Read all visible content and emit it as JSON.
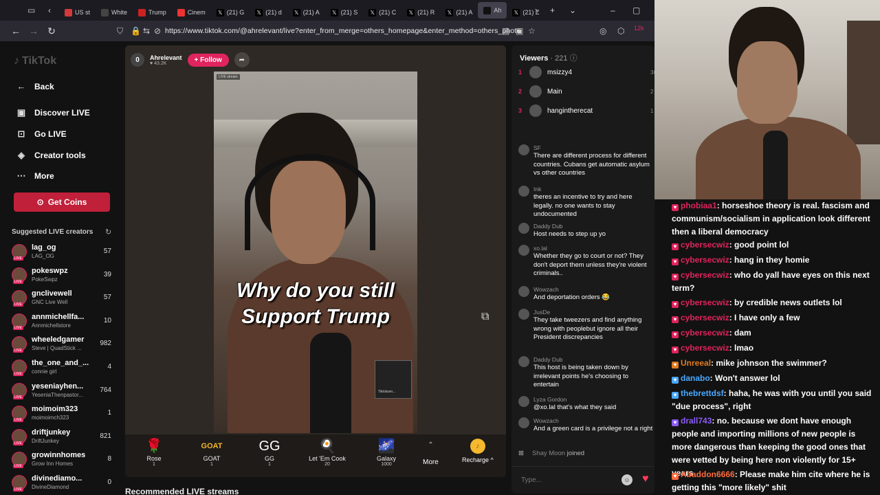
{
  "browser": {
    "tabs": [
      {
        "label": "US st",
        "color": "#d43a3a"
      },
      {
        "label": "White",
        "color": "#444"
      },
      {
        "label": "Trump",
        "color": "#c22"
      },
      {
        "label": "Cinem",
        "color": "#e33"
      },
      {
        "label": "(21) G",
        "color": "#000"
      },
      {
        "label": "(21) d",
        "color": "#000"
      },
      {
        "label": "(21) A",
        "color": "#000"
      },
      {
        "label": "(21) S",
        "color": "#000"
      },
      {
        "label": "(21) C",
        "color": "#000"
      },
      {
        "label": "(21) R",
        "color": "#000"
      },
      {
        "label": "(21) A",
        "color": "#000"
      },
      {
        "label": "Ah",
        "color": "#111"
      },
      {
        "label": "(21) Z",
        "color": "#000"
      }
    ],
    "url": "https://www.tiktok.com/@ahrelevant/live?enter_from_merge=others_homepage&enter_method=others_photo",
    "notification_count": "12k"
  },
  "sidebar": {
    "logo": "TikTok",
    "nav": [
      {
        "label": "Back",
        "icon": "←"
      },
      {
        "label": "Discover LIVE",
        "icon": "▣"
      },
      {
        "label": "Go LIVE",
        "icon": "⊡"
      },
      {
        "label": "Creator tools",
        "icon": "◈"
      },
      {
        "label": "More",
        "icon": "⋯"
      }
    ],
    "coins_label": "Get Coins",
    "suggested_title": "Suggested LIVE creators",
    "creators": [
      {
        "name": "lag_og",
        "sub": "LAG_OG",
        "count": "57"
      },
      {
        "name": "pokeswpz",
        "sub": "PokeSwpz",
        "count": "39"
      },
      {
        "name": "gnclivewell",
        "sub": "GNC Live Well",
        "count": "57"
      },
      {
        "name": "annmichellfa...",
        "sub": "Annmichellstore",
        "count": "10"
      },
      {
        "name": "wheeledgamer",
        "sub": "Steve | QuadStick ...",
        "count": "982"
      },
      {
        "name": "the_one_and_...",
        "sub": "connie girl",
        "count": "4"
      },
      {
        "name": "yeseniayhen...",
        "sub": "YeseniaThenpastor...",
        "count": "764"
      },
      {
        "name": "moimoim323",
        "sub": "moimoimch323",
        "count": "1"
      },
      {
        "name": "driftjunkey",
        "sub": "DriftJunkey",
        "count": "821"
      },
      {
        "name": "growinnhomes",
        "sub": "Grow Inn Homes",
        "count": "8"
      },
      {
        "name": "divinediamo...",
        "sub": "DivineDiamond",
        "count": "0"
      }
    ]
  },
  "stream": {
    "host_rank": "0",
    "host_name": "Ahrelevant",
    "host_likes": "♥ 43.2K",
    "follow_label": "+ Follow",
    "overlay_line1": "Why do you  still",
    "overlay_line2": "Support Trump",
    "badge": "LIVE stream",
    "pip_label": "Tiktoksen...",
    "gifts": [
      {
        "name": "Rose",
        "cost": "1",
        "icon": "🌹"
      },
      {
        "name": "GOAT",
        "cost": "1",
        "icon": "GOAT"
      },
      {
        "name": "GG",
        "cost": "1",
        "icon": "GG"
      },
      {
        "name": "Let 'Em Cook",
        "cost": "20",
        "icon": "🍳"
      },
      {
        "name": "Galaxy",
        "cost": "1000",
        "icon": "🌌"
      }
    ],
    "more_label": "More",
    "recharge_label": "Recharge ^",
    "recommended_label": "Recommended LIVE streams"
  },
  "chat": {
    "viewers_label": "Viewers",
    "viewers_count": "· 221",
    "top_viewers": [
      {
        "rank": "1",
        "name": "msizzy4",
        "score": "36"
      },
      {
        "rank": "2",
        "name": "Main",
        "score": "2"
      },
      {
        "rank": "3",
        "name": "hangintherecat",
        "score": "1"
      }
    ],
    "messages": [
      {
        "user": "SF",
        "text": "There are different process for different countries. Cubans get automatic asylum vs other countries"
      },
      {
        "user": "Ink",
        "text": "theres an incentive to try and here legally. no one wants to stay undocumented"
      },
      {
        "user": "Daddy Dub",
        "text": "Host needs to step up yo"
      },
      {
        "user": "xo.lal",
        "text": "Whether they go to court or not? They don't deport them unless they're violent criminals.."
      },
      {
        "user": "Wowzach",
        "text": "And deportation orders 😂"
      },
      {
        "user": "JusDe",
        "text": "They take tweezers and find anything wrong with peoplebut ignore all their President discrepancies"
      },
      {
        "user": "Daddy Dub",
        "text": "This host is being taken down by irrelevant points he's choosing to entertain"
      },
      {
        "user": "Lyza Gordon",
        "text": "@xo.lal that's what they said"
      },
      {
        "user": "Wowzach",
        "text": "And a green card is a privilege not a right"
      }
    ],
    "joined_user": "Shay Moon",
    "joined_text": "joined",
    "type_placeholder": "Type..."
  },
  "stream_chat": [
    {
      "user": "phobiaa1",
      "color": "#e0245e",
      "text": ": horseshoe theory is real. fascism and communism/socialism in application look different then a liberal democracy"
    },
    {
      "user": "cybersecwiz",
      "color": "#e0245e",
      "text": ": good point lol"
    },
    {
      "user": "cybersecwiz",
      "color": "#e0245e",
      "text": ": hang in they homie"
    },
    {
      "user": "cybersecwiz",
      "color": "#e0245e",
      "text": ": who do yall have eyes on this next term?"
    },
    {
      "user": "cybersecwiz",
      "color": "#e0245e",
      "text": ": by credible news outlets lol"
    },
    {
      "user": "cybersecwiz",
      "color": "#e0245e",
      "text": ": I have only a few"
    },
    {
      "user": "cybersecwiz",
      "color": "#e0245e",
      "text": ": dam"
    },
    {
      "user": "cybersecwiz",
      "color": "#e0245e",
      "text": ": lmao"
    },
    {
      "user": "Unreeal",
      "color": "#e07b20",
      "text": ": mike johnson the swimmer?"
    },
    {
      "user": "danabo",
      "color": "#4aa8ff",
      "text": ": Won't answer lol"
    },
    {
      "user": "thebrettdsf",
      "color": "#4aa8ff",
      "text": ": haha, he was with you until you said \"due process\", right"
    },
    {
      "user": "drall743",
      "color": "#8a5cf6",
      "text": ": no. because we dont have enough people and importing millions of new people is more dangerous than keeping the good ones that were vetted by being here non violently for 15+ years"
    },
    {
      "user": "Abaddon6666",
      "color": "#ff6b3d",
      "text": ": Please make him cite where he is getting this \"more likely\" shit"
    }
  ]
}
